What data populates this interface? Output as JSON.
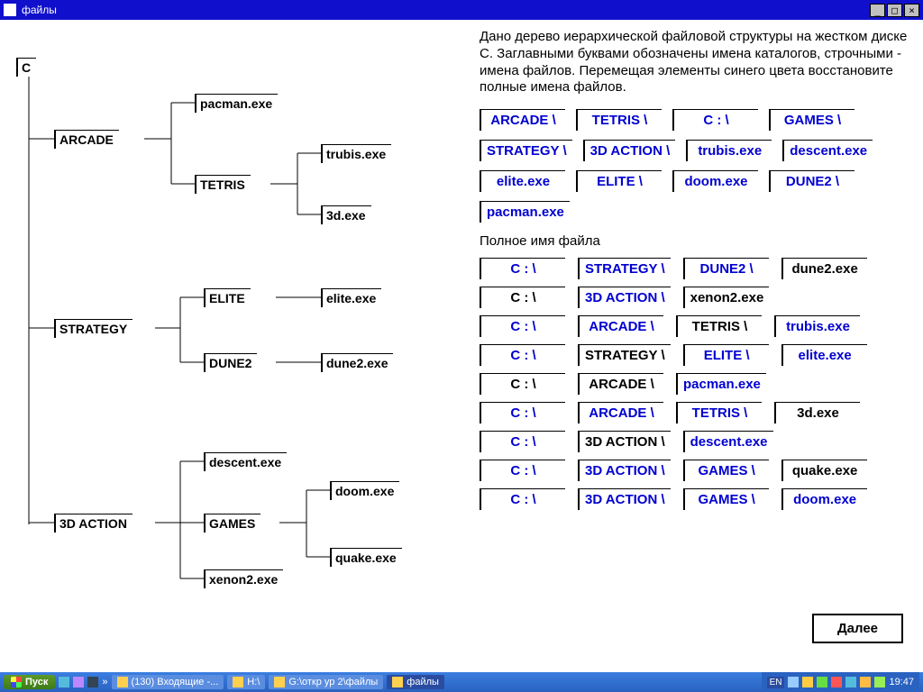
{
  "window": {
    "title": "файлы"
  },
  "tree": {
    "root": "C",
    "n_arcade": "ARCADE",
    "n_pacman": "pacman.exe",
    "n_tetris": "TETRIS",
    "n_trubis": "trubis.exe",
    "n_3d": "3d.exe",
    "n_strategy": "STRATEGY",
    "n_elite": "ELITE",
    "n_elitef": "elite.exe",
    "n_dune2": "DUNE2",
    "n_dune2f": "dune2.exe",
    "n_3daction": "3D ACTION",
    "n_descent": "descent.exe",
    "n_games": "GAMES",
    "n_doom": "doom.exe",
    "n_quake": "quake.exe",
    "n_xenon2": "xenon2.exe"
  },
  "instruction": "Дано дерево иерархической файловой структуры на жестком диске С. Заглавными буквами обозначены имена каталогов, строчными - имена файлов. Перемещая элементы синего цвета восстановите полные имена файлов.",
  "pool": [
    {
      "t": "ARCADE \\",
      "c": "blue"
    },
    {
      "t": "TETRIS \\",
      "c": "blue"
    },
    {
      "t": "C : \\",
      "c": "blue"
    },
    {
      "t": "GAMES \\",
      "c": "blue"
    },
    {
      "t": "STRATEGY \\",
      "c": "blue"
    },
    {
      "t": "3D ACTION \\",
      "c": "blue"
    },
    {
      "t": "trubis.exe",
      "c": "blue"
    },
    {
      "t": "descent.exe",
      "c": "blue"
    },
    {
      "t": "elite.exe",
      "c": "blue"
    },
    {
      "t": "ELITE \\",
      "c": "blue"
    },
    {
      "t": "doom.exe",
      "c": "blue"
    },
    {
      "t": "DUNE2 \\",
      "c": "blue"
    },
    {
      "t": "pacman.exe",
      "c": "blue"
    }
  ],
  "section_title": "Полное имя файла",
  "paths": [
    [
      {
        "t": "C : \\",
        "c": "blue"
      },
      {
        "t": "STRATEGY \\",
        "c": "blue"
      },
      {
        "t": "DUNE2 \\",
        "c": "blue"
      },
      {
        "t": "dune2.exe",
        "c": "black"
      }
    ],
    [
      {
        "t": "C : \\",
        "c": "black"
      },
      {
        "t": "3D ACTION \\",
        "c": "blue"
      },
      {
        "t": "xenon2.exe",
        "c": "black"
      }
    ],
    [
      {
        "t": "C : \\",
        "c": "blue"
      },
      {
        "t": "ARCADE \\",
        "c": "blue"
      },
      {
        "t": "TETRIS \\",
        "c": "black"
      },
      {
        "t": "trubis.exe",
        "c": "blue"
      }
    ],
    [
      {
        "t": "C : \\",
        "c": "blue"
      },
      {
        "t": "STRATEGY \\",
        "c": "black"
      },
      {
        "t": "ELITE \\",
        "c": "blue"
      },
      {
        "t": "elite.exe",
        "c": "blue"
      }
    ],
    [
      {
        "t": "C : \\",
        "c": "black"
      },
      {
        "t": "ARCADE \\",
        "c": "black"
      },
      {
        "t": "pacman.exe",
        "c": "blue"
      }
    ],
    [
      {
        "t": "C : \\",
        "c": "blue"
      },
      {
        "t": "ARCADE \\",
        "c": "blue"
      },
      {
        "t": "TETRIS \\",
        "c": "blue"
      },
      {
        "t": "3d.exe",
        "c": "black"
      }
    ],
    [
      {
        "t": "C : \\",
        "c": "blue"
      },
      {
        "t": "3D ACTION \\",
        "c": "black"
      },
      {
        "t": "descent.exe",
        "c": "blue"
      }
    ],
    [
      {
        "t": "C : \\",
        "c": "blue"
      },
      {
        "t": "3D ACTION \\",
        "c": "blue"
      },
      {
        "t": "GAMES \\",
        "c": "blue"
      },
      {
        "t": "quake.exe",
        "c": "black"
      }
    ],
    [
      {
        "t": "C : \\",
        "c": "blue"
      },
      {
        "t": "3D ACTION \\",
        "c": "blue"
      },
      {
        "t": "GAMES \\",
        "c": "blue"
      },
      {
        "t": "doom.exe",
        "c": "blue"
      }
    ]
  ],
  "next_button": "Далее",
  "taskbar": {
    "start": "Пуск",
    "items": [
      {
        "label": "(130) Входящие -..."
      },
      {
        "label": "H:\\"
      },
      {
        "label": "G:\\откр ур 2\\файлы"
      },
      {
        "label": "файлы"
      }
    ],
    "lang": "EN",
    "clock": "19:47"
  }
}
